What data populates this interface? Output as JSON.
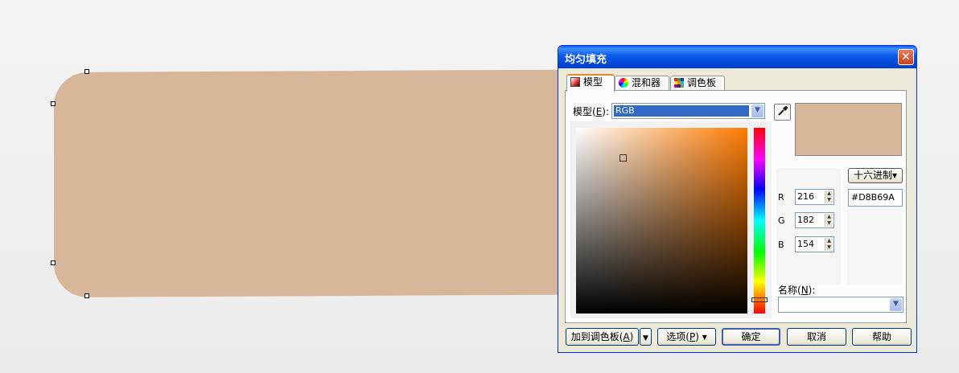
{
  "dialog": {
    "title": "均匀填充",
    "close_glyph": "✕"
  },
  "tabs": [
    {
      "label": "模型",
      "icon": "model-icon",
      "active": true
    },
    {
      "label": "混和器",
      "icon": "mixer-icon",
      "active": false
    },
    {
      "label": "调色板",
      "icon": "palette-icon",
      "active": false
    }
  ],
  "model": {
    "label": "模型(E):",
    "value": "RGB"
  },
  "color": {
    "hex": "#D8B69A",
    "r": "216",
    "g": "182",
    "b": "154",
    "r_label": "R",
    "g_label": "G",
    "b_label": "B"
  },
  "hex_mode_button": "十六进制▾",
  "name_label": "名称(N):",
  "name_value": "",
  "buttons": {
    "add_palette": "加到调色板(A)",
    "options": "选项(P) ▾",
    "ok": "确定",
    "cancel": "取消",
    "help": "帮助"
  },
  "colors": {
    "shape_fill": "#D8B69A",
    "title_bar": "#0a5ae8",
    "dialog_bg": "#ece9d8"
  }
}
